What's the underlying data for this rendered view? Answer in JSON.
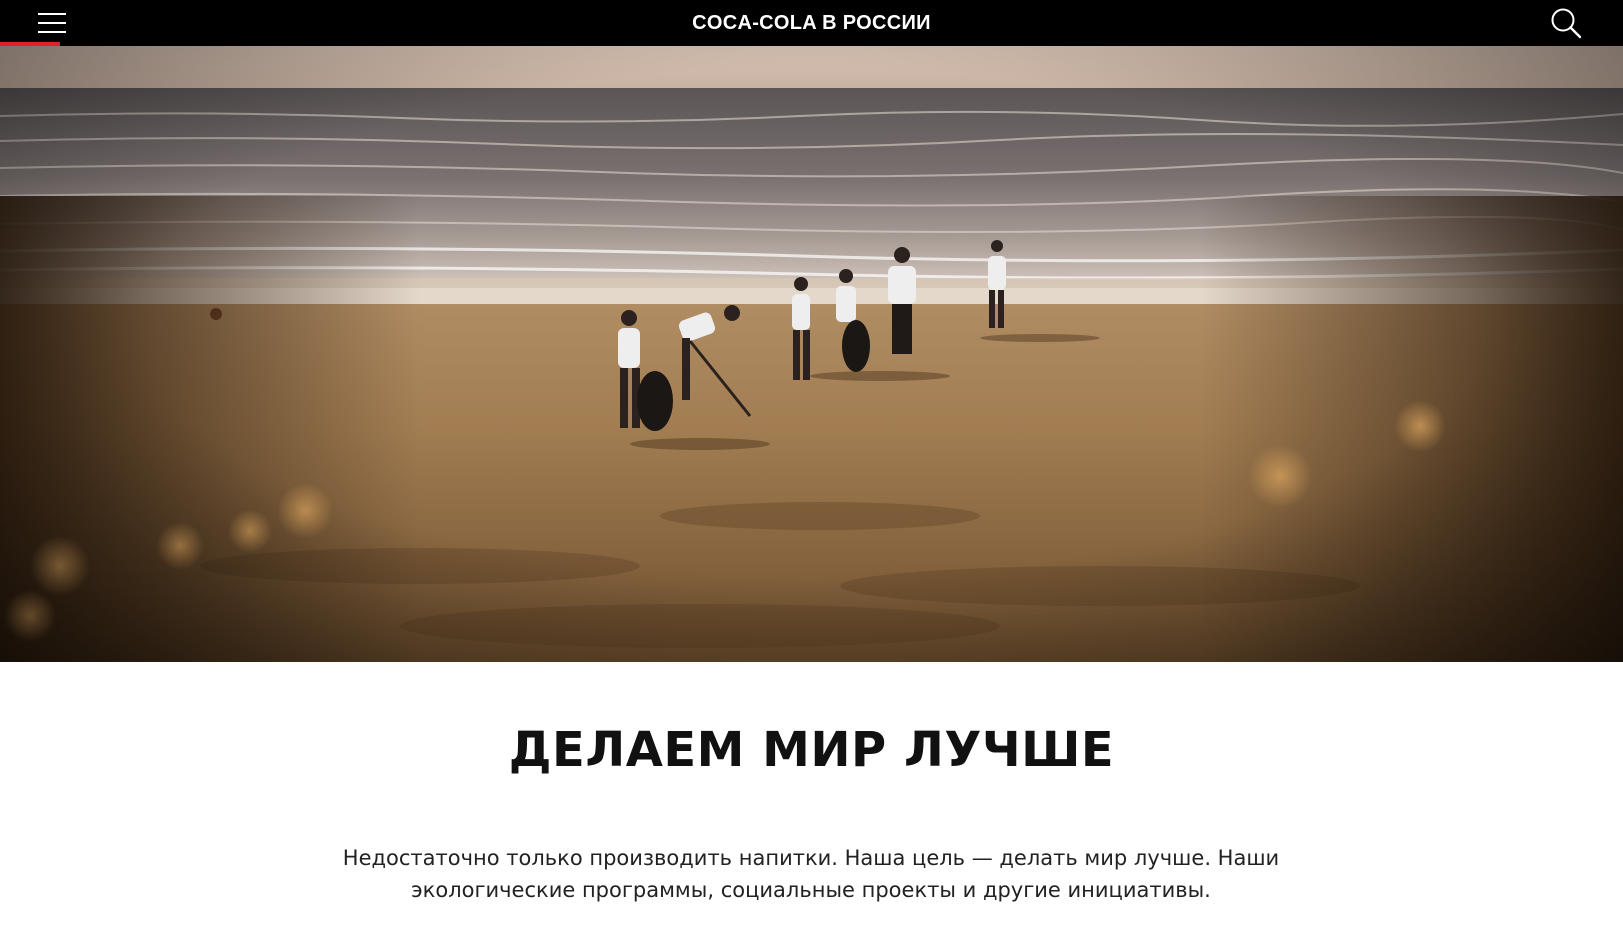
{
  "header": {
    "title": "COCA-COLA В РОССИИ",
    "menu_icon": "hamburger-menu-icon",
    "search_icon": "search-icon",
    "accent_color": "#e41e2b",
    "background_color": "#000000"
  },
  "hero": {
    "image_subject": "beach-cleanup-volunteers-photo"
  },
  "main": {
    "headline": "ДЕЛАЕМ МИР ЛУЧШЕ",
    "intro": "Недостаточно только производить напитки. Наша цель — делать мир лучше. Наши экологические программы, социальные проекты и другие инициативы."
  }
}
